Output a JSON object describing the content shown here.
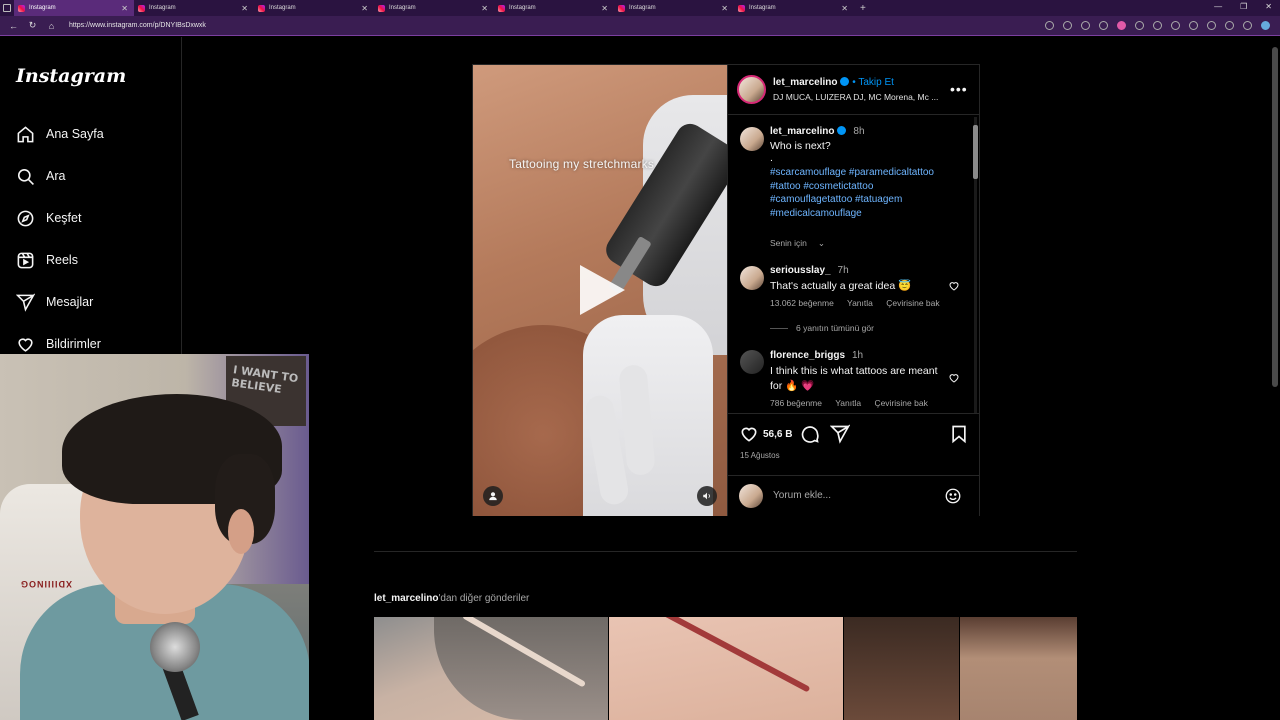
{
  "browser": {
    "tabs": [
      {
        "label": "Instagram",
        "active": true
      },
      {
        "label": "Instagram",
        "active": false
      },
      {
        "label": "Instagram",
        "active": false
      },
      {
        "label": "Instagram",
        "active": false
      },
      {
        "label": "Instagram",
        "active": false
      },
      {
        "label": "Instagram",
        "active": false
      },
      {
        "label": "Instagram",
        "active": false
      }
    ],
    "new_tab": "+",
    "url": "https://www.instagram.com/p/DNYIBsDxwxk"
  },
  "sidebar": {
    "logo": "Instagram",
    "items": [
      {
        "label": "Ana Sayfa",
        "icon": "home-icon"
      },
      {
        "label": "Ara",
        "icon": "search-icon"
      },
      {
        "label": "Keşfet",
        "icon": "compass-icon"
      },
      {
        "label": "Reels",
        "icon": "reels-icon"
      },
      {
        "label": "Mesajlar",
        "icon": "send-icon"
      },
      {
        "label": "Bildirimler",
        "icon": "heart-icon"
      }
    ]
  },
  "webcam": {
    "poster_text": "I WANT TO BELIEVE",
    "chair_text": "XDIIIINOG"
  },
  "post": {
    "media": {
      "overlay_text": "Tattooing my stretchmarks"
    },
    "header": {
      "username": "let_marcelino",
      "follow_label": "• Takip Et",
      "subtitle": "DJ MUCA, LUIZERA DJ, MC Morena, Mc ..."
    },
    "caption": {
      "username": "let_marcelino",
      "time": "8h",
      "text": "Who is next?",
      "dot": ".",
      "hashtags": [
        "#scarcamouflage #paramedicaltattoo",
        "#tattoo #cosmetictattoo",
        "#camouflagetattoo #tatuagem",
        "#medicalcamouflage"
      ],
      "for_you": "Senin için"
    },
    "comments": [
      {
        "username": "seriousslay_",
        "time": "7h",
        "text": "That's actually a great idea 😇",
        "likes": "13.062 beğenme",
        "reply": "Yanıtla",
        "translate": "Çevirisine bak",
        "view_replies": "6 yanıtın tümünü gör"
      },
      {
        "username": "florence_briggs",
        "time": "1h",
        "text": "I think this is what tattoos are meant for 🔥 💗",
        "likes": "786 beğenme",
        "reply": "Yanıtla",
        "translate": "Çevirisine bak"
      }
    ],
    "likes": "56,6 B",
    "date": "15 Ağustos",
    "comment_placeholder": "Yorum ekle..."
  },
  "more_posts": {
    "username": "let_marcelino",
    "suffix": "'dan diğer gönderiler",
    "thumbnails": [
      {
        "name": "hairline-scar"
      },
      {
        "name": "red-scar"
      },
      {
        "name": "dark-skin"
      },
      {
        "name": "arm-skin"
      }
    ]
  },
  "colors": {
    "accent": "#0095f6",
    "tab_bar": "#2a1340",
    "address_bar": "#3a1d52",
    "background": "#000000"
  }
}
